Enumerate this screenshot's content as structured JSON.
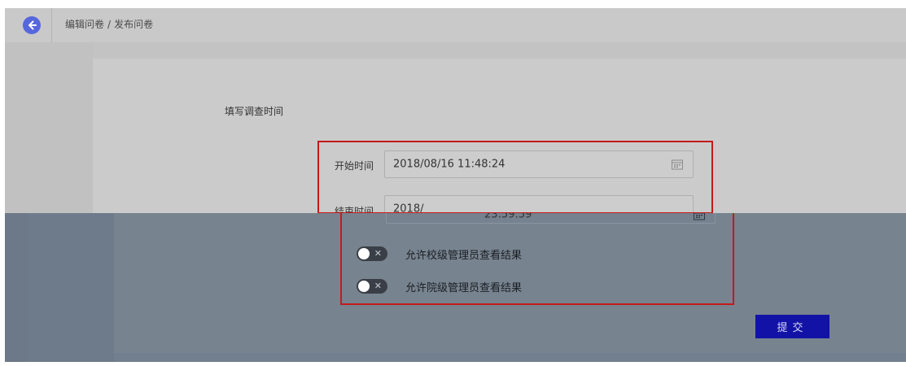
{
  "header": {
    "breadcrumb": [
      "编辑问卷",
      "发布问卷"
    ],
    "separator": "/"
  },
  "form": {
    "section_label": "填写调查时间",
    "start": {
      "label": "开始时间",
      "value": "2018/08/16 11:48:24"
    },
    "end": {
      "label": "结束时间",
      "value_partial": "2018/",
      "value": "23:59:59",
      "value_garbled": "2018/1..,'làï1 23:59:59"
    },
    "toggles": [
      {
        "label": "允许校级管理员查看结果",
        "on": false
      },
      {
        "label": "允许院级管理员查看结果",
        "on": false
      }
    ],
    "submit_label": "提交"
  },
  "icons": {
    "back": "arrow-left-icon",
    "calendar": "calendar-icon",
    "toggle_off": "close-icon"
  },
  "colors": {
    "back_button": "#5667dd",
    "highlight": "#c41a1a",
    "submit": "#1212a6",
    "lower_overlay": "#727f8e"
  }
}
